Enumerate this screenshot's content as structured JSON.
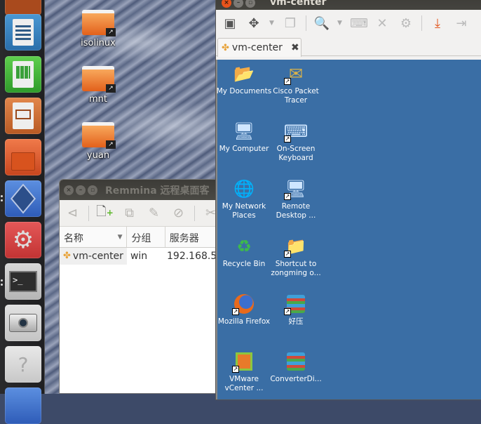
{
  "launcher": {
    "items": [
      {
        "name": "ubuntu-software-partial",
        "icon": "app-icon",
        "color": "#b5521f"
      },
      {
        "name": "libreoffice-writer",
        "icon": "writer-icon",
        "color": "#2e7fbf"
      },
      {
        "name": "libreoffice-calc",
        "icon": "calc-icon",
        "color": "#3fa83a"
      },
      {
        "name": "libreoffice-impress",
        "icon": "impress-icon",
        "color": "#c9652e"
      },
      {
        "name": "ubuntu-software-center",
        "icon": "shopping-bag-icon",
        "color": "#d8532a"
      },
      {
        "name": "virtualbox",
        "icon": "virtualbox-icon",
        "color": "#3e6fc7"
      },
      {
        "name": "system-settings",
        "icon": "settings-icon",
        "color": "#d64343"
      },
      {
        "name": "terminal",
        "icon": "terminal-icon",
        "color": "#c9c9c9"
      },
      {
        "name": "camera",
        "icon": "camera-icon",
        "color": "#d4d4d4"
      },
      {
        "name": "unknown-app",
        "icon": "question-icon",
        "color": "#d6d6d6"
      }
    ]
  },
  "desktop": {
    "icons": [
      {
        "label": "isolinux"
      },
      {
        "label": "mnt"
      },
      {
        "label": "yuan"
      }
    ]
  },
  "remmina": {
    "title": "Remmina 远程桌面客",
    "toolbar": [
      "connect",
      "new",
      "copy",
      "edit",
      "delete",
      "tools"
    ],
    "columns": [
      "名称",
      "分组",
      "服务器"
    ],
    "rows": [
      {
        "name": "vm-center",
        "group": "win",
        "server": "192.168.5"
      }
    ]
  },
  "vm_window": {
    "title": "vm-center",
    "tab_label": "vm-center",
    "remote_desktop": {
      "background": "#3a6ea5",
      "icons": [
        {
          "label": "My Documents"
        },
        {
          "label": "Cisco Packet Tracer"
        },
        {
          "label": "My Computer"
        },
        {
          "label": "On-Screen Keyboard"
        },
        {
          "label": "My Network Places"
        },
        {
          "label": "Remote Desktop ..."
        },
        {
          "label": "Recycle Bin"
        },
        {
          "label": "Shortcut to zongming o..."
        },
        {
          "label": "Mozilla Firefox"
        },
        {
          "label": "好压"
        },
        {
          "label": "VMware vCenter ..."
        },
        {
          "label": "ConverterDi..."
        }
      ]
    }
  }
}
